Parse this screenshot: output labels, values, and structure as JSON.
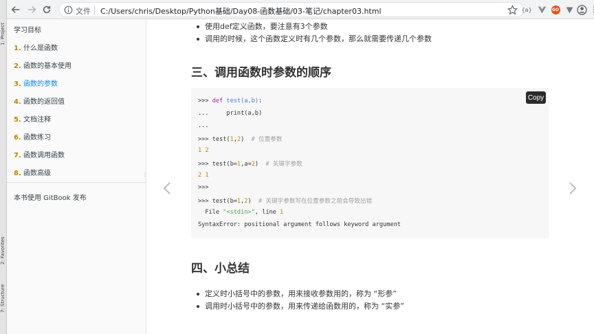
{
  "ide": {
    "tabs": [
      "1: Project",
      "2: Favorites",
      "7: Structure"
    ]
  },
  "browser": {
    "file_label": "文件",
    "url": "C:/Users/chris/Desktop/Python基础/Day08-函数基础/03-笔记/chapter03.html",
    "ext1": "{a}",
    "ext3": "GO"
  },
  "sidebar": {
    "items": [
      {
        "num": "",
        "label": "学习目标"
      },
      {
        "num": "1.",
        "label": "什么是函数"
      },
      {
        "num": "2.",
        "label": "函数的基本使用"
      },
      {
        "num": "3.",
        "label": "函数的参数"
      },
      {
        "num": "4.",
        "label": "函数的返回值"
      },
      {
        "num": "5.",
        "label": "文档注释"
      },
      {
        "num": "6.",
        "label": "函数练习"
      },
      {
        "num": "7.",
        "label": "函数调用函数"
      },
      {
        "num": "8.",
        "label": "函数高级"
      }
    ],
    "footer": "本书使用 GitBook 发布",
    "active_index": 3,
    "active_color": "#008cff"
  },
  "content": {
    "top_bullets": [
      "使用def定义函数，要注意有3个参数",
      "调用的时候，这个函数定义时有几个参数，那么就需要传递几个参数"
    ],
    "section3_title": "三、调用函数时参数的顺序",
    "copy_label": "Copy",
    "code": {
      "l1_prompt": ">>> ",
      "l1_kw": "def",
      "l1_fn": "test",
      "l1_args": "(a,b)",
      "l1_end": ":",
      "l2": "...     print(a,b)",
      "l3": "...",
      "l4_prompt": ">>> test(",
      "l4_n1": "1",
      "l4_comma": ",",
      "l4_n2": "2",
      "l4_close": ")  ",
      "l4_comment": "# 位置参数",
      "l5_a": "1",
      "l5_b": "2",
      "l6_prompt": ">>> test(b=",
      "l6_n1": "1",
      "l6_mid": ",a=",
      "l6_n2": "2",
      "l6_close": ")  ",
      "l6_comment": "# 关键字参数",
      "l7_a": "2",
      "l7_b": "1",
      "l8": ">>>",
      "l9_prompt": ">>> test(b=",
      "l9_n1": "1",
      "l9_comma": ",",
      "l9_n2": "2",
      "l9_close": ")  ",
      "l9_comment": "# 关键字参数写在位置参数之前会导致出错",
      "l10_a": "  File ",
      "l10_str": "\"<stdin>\"",
      "l10_b": ", line ",
      "l10_num": "1",
      "l11": "SyntaxError: positional argument follows keyword argument"
    },
    "section4_title": "四、小总结",
    "bottom_bullets": [
      "定义时小括号中的参数，用来接收参数用的，称为 “形参”",
      "调用时小括号中的参数，用来传递给函数用的，称为 “实参”"
    ]
  }
}
